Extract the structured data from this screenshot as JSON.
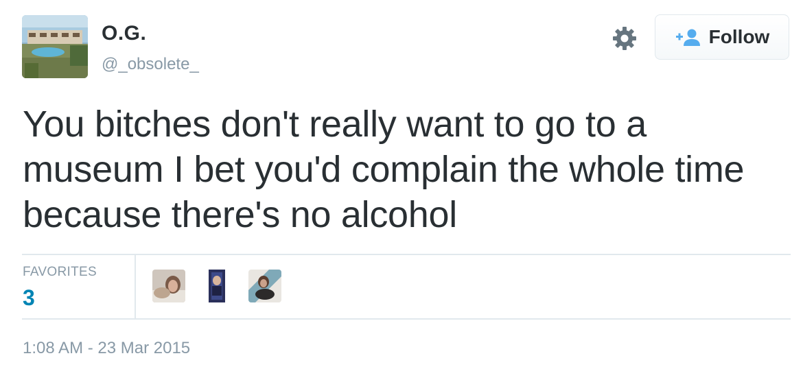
{
  "user": {
    "display_name": "O.G.",
    "handle": "@_obsolete_",
    "avatar_icon": "profile-photo"
  },
  "actions": {
    "settings_icon": "gear-icon",
    "follow_label": "Follow",
    "follow_icon": "add-user-icon"
  },
  "tweet": {
    "text": "You bitches don't really want to go to a museum I bet you'd complain the whole time because there's no alcohol"
  },
  "stats": {
    "favorites_label": "FAVORITES",
    "favorites_count": "3"
  },
  "favoriters": [
    "favoriter-avatar-1",
    "favoriter-avatar-2",
    "favoriter-avatar-3"
  ],
  "timestamp": "1:08 AM - 23 Mar 2015",
  "colors": {
    "text": "#292f33",
    "muted": "#8899a6",
    "link_blue": "#0084b4",
    "follow_icon_blue": "#55acee",
    "border": "#e1e8ed"
  }
}
